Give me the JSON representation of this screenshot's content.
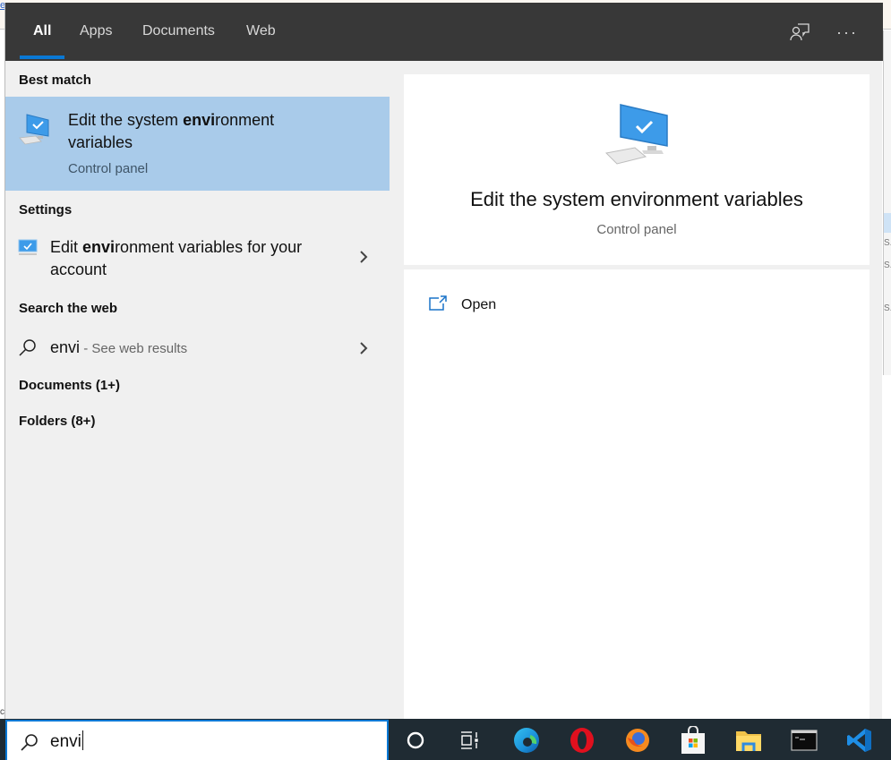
{
  "header": {
    "tabs": [
      {
        "label": "All",
        "active": true
      },
      {
        "label": "Apps",
        "active": false
      },
      {
        "label": "Documents",
        "active": false
      },
      {
        "label": "Web",
        "active": false
      }
    ],
    "feedback_icon": "feedback-person-icon",
    "more_icon": "more-options-icon",
    "more_label": "···"
  },
  "results": {
    "best_match": {
      "heading": "Best match",
      "title_before": "Edit the system ",
      "title_bold": "envi",
      "title_after": "ronment variables",
      "subtitle": "Control panel",
      "icon": "computer-check-icon"
    },
    "settings": {
      "heading": "Settings",
      "item": {
        "text_before": "Edit ",
        "text_bold": "envi",
        "text_after": "ronment variables for your account",
        "icon": "monitor-settings-icon"
      }
    },
    "web": {
      "heading": "Search the web",
      "query": "envi",
      "suffix": " - See web results",
      "icon": "search-icon"
    },
    "documents": {
      "label": "Documents (1+)"
    },
    "folders": {
      "label": "Folders (8+)"
    }
  },
  "preview": {
    "title": "Edit the system environment variables",
    "subtitle": "Control panel",
    "actions": [
      {
        "label": "Open",
        "icon": "open-external-icon"
      }
    ]
  },
  "taskbar": {
    "search_value": "envi",
    "items": [
      {
        "name": "cortana",
        "icon": "cortana-circle-icon"
      },
      {
        "name": "task-view",
        "icon": "task-view-icon"
      },
      {
        "name": "edge",
        "icon": "edge-browser-icon"
      },
      {
        "name": "opera",
        "icon": "opera-browser-icon"
      },
      {
        "name": "firefox",
        "icon": "firefox-browser-icon"
      },
      {
        "name": "microsoft-store",
        "icon": "store-bag-icon"
      },
      {
        "name": "file-explorer",
        "icon": "folder-icon"
      },
      {
        "name": "command-prompt",
        "icon": "terminal-icon"
      },
      {
        "name": "vscode",
        "icon": "vscode-icon"
      }
    ]
  },
  "colors": {
    "accent": "#0a78d4",
    "header_bg": "#383838",
    "selected_bg": "#a9cbea",
    "panel_bg": "#f0f0f0",
    "taskbar_bg": "#1f2b33"
  },
  "background_window": {
    "right_edge_labels": [
      "S...",
      "S...",
      "S..."
    ]
  }
}
